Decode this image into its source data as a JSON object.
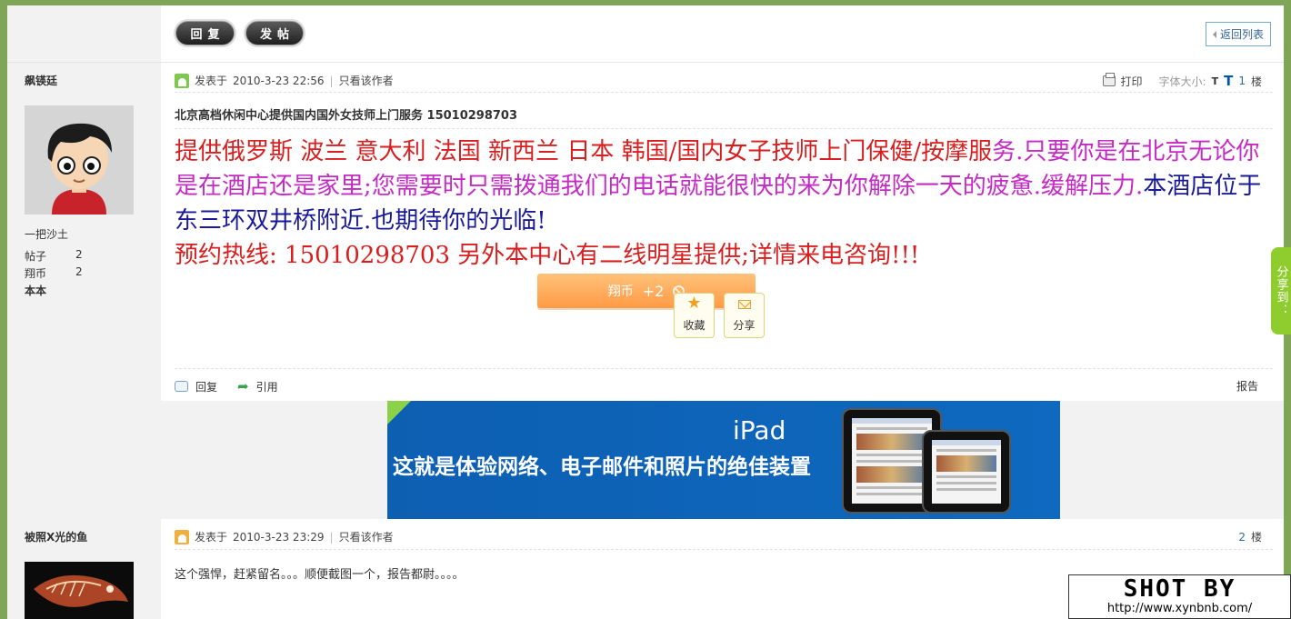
{
  "toolbar": {
    "reply_label": "回复",
    "post_label": "发帖",
    "back_label": "返回列表"
  },
  "post1": {
    "author": "飙锳廷",
    "user_group": "一把沙土",
    "stats": [
      {
        "label": "帖子",
        "value": "2"
      },
      {
        "label": "翔币",
        "value": "2"
      }
    ],
    "signature": "本本",
    "posted_prefix": "发表于",
    "posted_time": "2010-3-23 22:56",
    "only_author": "只看该作者",
    "print_label": "打印",
    "font_size_label": "字体大小:",
    "font_small": "T",
    "font_big": "T",
    "floor_num": "1",
    "floor_unit": "楼",
    "title": "北京高档休闲中心提供国内国外女技师上门服务 15010298703",
    "body_red_1": "提供俄罗斯 波兰 意大利 法国 新西兰 日本 韩国/国内女子技师上门保健/按摩服",
    "body_magenta": "务.只要你是在北京无论你是在酒店还是家里;您需要时只需拨通我们的电话就能很快的来为你解除一天的疲惫.缓解压力.",
    "body_navy": "本酒店位于东三环双井桥附近.也期待你的光临!",
    "body_red_2": "预约热线:  15010298703 另外本中心有二线明星提供;详情来电咨询!!!",
    "reward_label": "翔币",
    "reward_value": "+2",
    "favorite_label": "收藏",
    "share_label": "分享",
    "reply_action": "回复",
    "quote_action": "引用",
    "report_label": "报告"
  },
  "ad": {
    "title": "iPad",
    "text": "这就是体验网络、电子邮件和照片的绝佳装置"
  },
  "post2": {
    "author": "被照X光的鱼",
    "posted_prefix": "发表于",
    "posted_time": "2010-3-23 23:29",
    "only_author": "只看该作者",
    "floor_num": "2",
    "floor_unit": "楼",
    "body": "这个强悍，赶紧留名。。。顺便截图一个，报告都尉。。。。"
  },
  "share_tab": "分享到：",
  "watermark": {
    "text": "SHOT BY",
    "url": "http://www.xynbnb.com/"
  }
}
